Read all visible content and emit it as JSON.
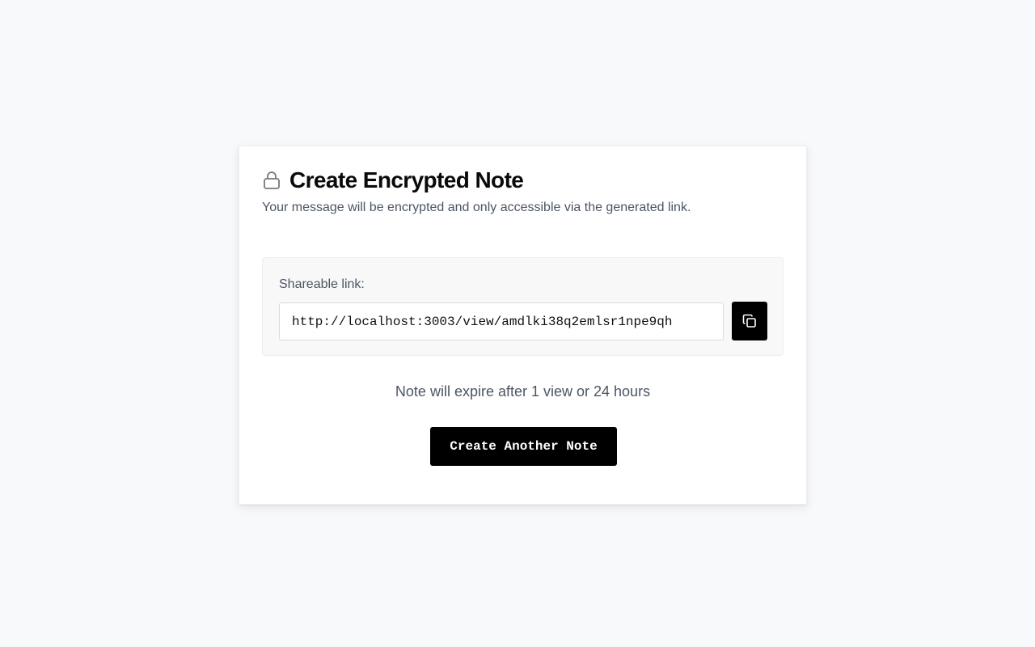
{
  "card": {
    "title": "Create Encrypted Note",
    "title_icon": "lock-icon",
    "subtitle": "Your message will be encrypted and only accessible via the generated link."
  },
  "share": {
    "label": "Shareable link:",
    "url": "http://localhost:3003/view/amdlki38q2emlsr1npe9qh",
    "copy_icon": "copy-icon"
  },
  "expiry": {
    "text": "Note will expire after 1 view or 24 hours"
  },
  "actions": {
    "create_another_label": "Create Another Note"
  },
  "colors": {
    "background": "#f8f9fb",
    "button": "#000000",
    "muted_text": "#4b5563"
  }
}
